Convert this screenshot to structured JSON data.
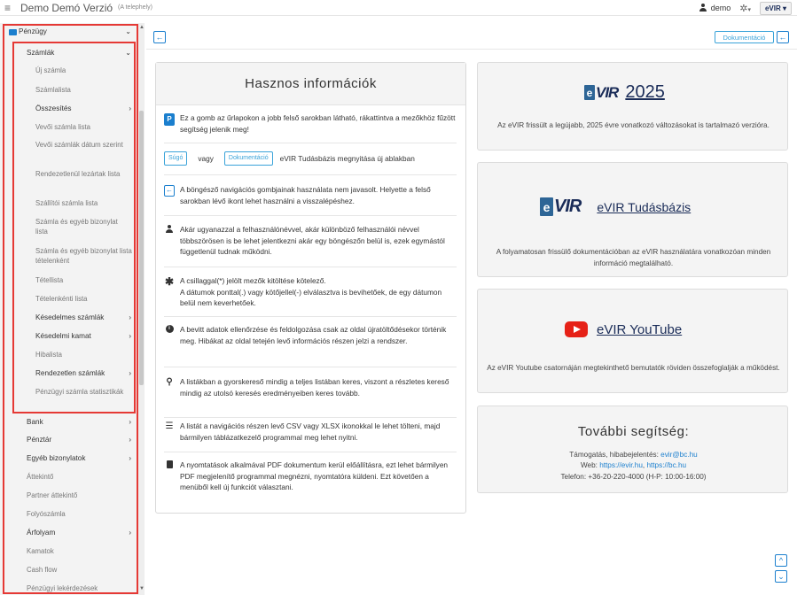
{
  "header": {
    "title": "Demo Demó Verzió",
    "subtitle": "(A telephely)",
    "user": "demo",
    "gear_caret": "▾",
    "logo_text": "eVIR ▾"
  },
  "sidebar": {
    "items": [
      {
        "label": "Pénzügy",
        "chev": "⌄"
      },
      {
        "label": "Számlák",
        "chev": "⌄"
      },
      {
        "label": "Új számla"
      },
      {
        "label": "Számlalista"
      },
      {
        "label": "Összesítés",
        "chev": "›"
      },
      {
        "label": "Vevői számla lista"
      },
      {
        "label": "Vevői számlák dátum szerint"
      },
      {
        "label": "Rendezetlenül lezártak lista"
      },
      {
        "label": "Szállítói számla lista"
      },
      {
        "label": "Számla és egyéb bizonylat lista"
      },
      {
        "label": "Számla és egyéb bizonylat lista tételenként"
      },
      {
        "label": "Tétellista"
      },
      {
        "label": "Tételenkénti lista"
      },
      {
        "label": "Késedelmes számlák",
        "chev": "›"
      },
      {
        "label": "Késedelmi kamat",
        "chev": "›"
      },
      {
        "label": "Hibalista"
      },
      {
        "label": "Rendezetlen számlák",
        "chev": "›"
      },
      {
        "label": "Pénzügyi számla statisztikák"
      },
      {
        "label": "Bank",
        "chev": "›"
      },
      {
        "label": "Pénztár",
        "chev": "›"
      },
      {
        "label": "Egyéb bizonylatok",
        "chev": "›"
      },
      {
        "label": "Áttekintő"
      },
      {
        "label": "Partner áttekintő"
      },
      {
        "label": "Folyószámla"
      },
      {
        "label": "Árfolyam",
        "chev": "›"
      },
      {
        "label": "Kamatok"
      },
      {
        "label": "Cash flow"
      },
      {
        "label": "Pénzügyi lekérdezések"
      }
    ]
  },
  "toolbar": {
    "back_icon": "←",
    "doc_label": "Dokumentáció",
    "scroll_up": "^",
    "scroll_down": "⌄"
  },
  "info": {
    "title": "Hasznos információk",
    "icon_p": "P",
    "row1": "Ez a gomb az űrlapokon a jobb felső sarokban látható, rákattintva a mezőkhöz fűzött segítség jelenik meg!",
    "chip_sugo": "Súgó",
    "vagy": "vagy",
    "chip_doc": "Dokumentáció",
    "row2": "eVIR Tudásbázis megnyitása új ablakban",
    "row3": "A böngésző navigációs gombjainak használata nem javasolt. Helyette a felső sarokban lévő ikont lehet használni a visszalépéshez.",
    "row4": "Akár ugyanazzal a felhasználónévvel, akár különböző felhasználói névvel többszörösen is be lehet jelentkezni akár egy böngészőn belül is, ezek egymástól függetlenül tudnak működni.",
    "row5a": "A csillaggal(*) jelölt mezők kitöltése kötelező.",
    "row5b": "A dátumok ponttal(.) vagy kötőjellel(-) elválasztva is bevihetőek, de egy dátumon belül nem keverhetőek.",
    "row6": "A bevitt adatok ellenőrzése és feldolgozása csak az oldal újratöltődésekor történik meg. Hibákat az oldal tetején levő információs részen jelzi a rendszer.",
    "row7": "A listákban a gyorskereső mindig a teljes listában keres, viszont a részletes kereső mindig az utolsó keresés eredményeiben keres tovább.",
    "row8": "A listát a navigációs részen levő CSV vagy XLSX ikonokkal le lehet tölteni, majd bármilyen táblázatkezelő programmal meg lehet nyitni.",
    "row9": "A nyomtatások alkalmával PDF dokumentum kerül előállításra, ezt lehet bármilyen PDF megjelenítő programmal megnézni, nyomtatóra küldeni. Ezt követően a menüből kell új funkciót választani."
  },
  "cards": {
    "c1_title": "2025",
    "c1_desc": "Az eVIR frissült a legújabb, 2025 évre vonatkozó változásokat is tartalmazó verzióra.",
    "c2_title": "eVIR Tudásbázis",
    "c2_desc": "A folyamatosan frissülő dokumentációban az eVIR használatára vonatkozóan minden információ megtalálható.",
    "c3_title": "eVIR YouTube",
    "c3_desc": "Az eVIR Youtube csatornáján megtekinthető bemutatók röviden összefoglalják a működést.",
    "help_title": "További segítség:",
    "help_line1_label": "Támogatás, hibabejelentés:",
    "help_email": "evir@bc.hu",
    "help_line2_label": "Web:",
    "help_web1": "https://evir.hu",
    "help_web_sep": ",",
    "help_web2": "https://bc.hu",
    "help_line3": "Telefon: +36-20-220-4000 (H-P: 10:00-16:00)",
    "logo_e": "e",
    "logo_vir": "VIR"
  }
}
